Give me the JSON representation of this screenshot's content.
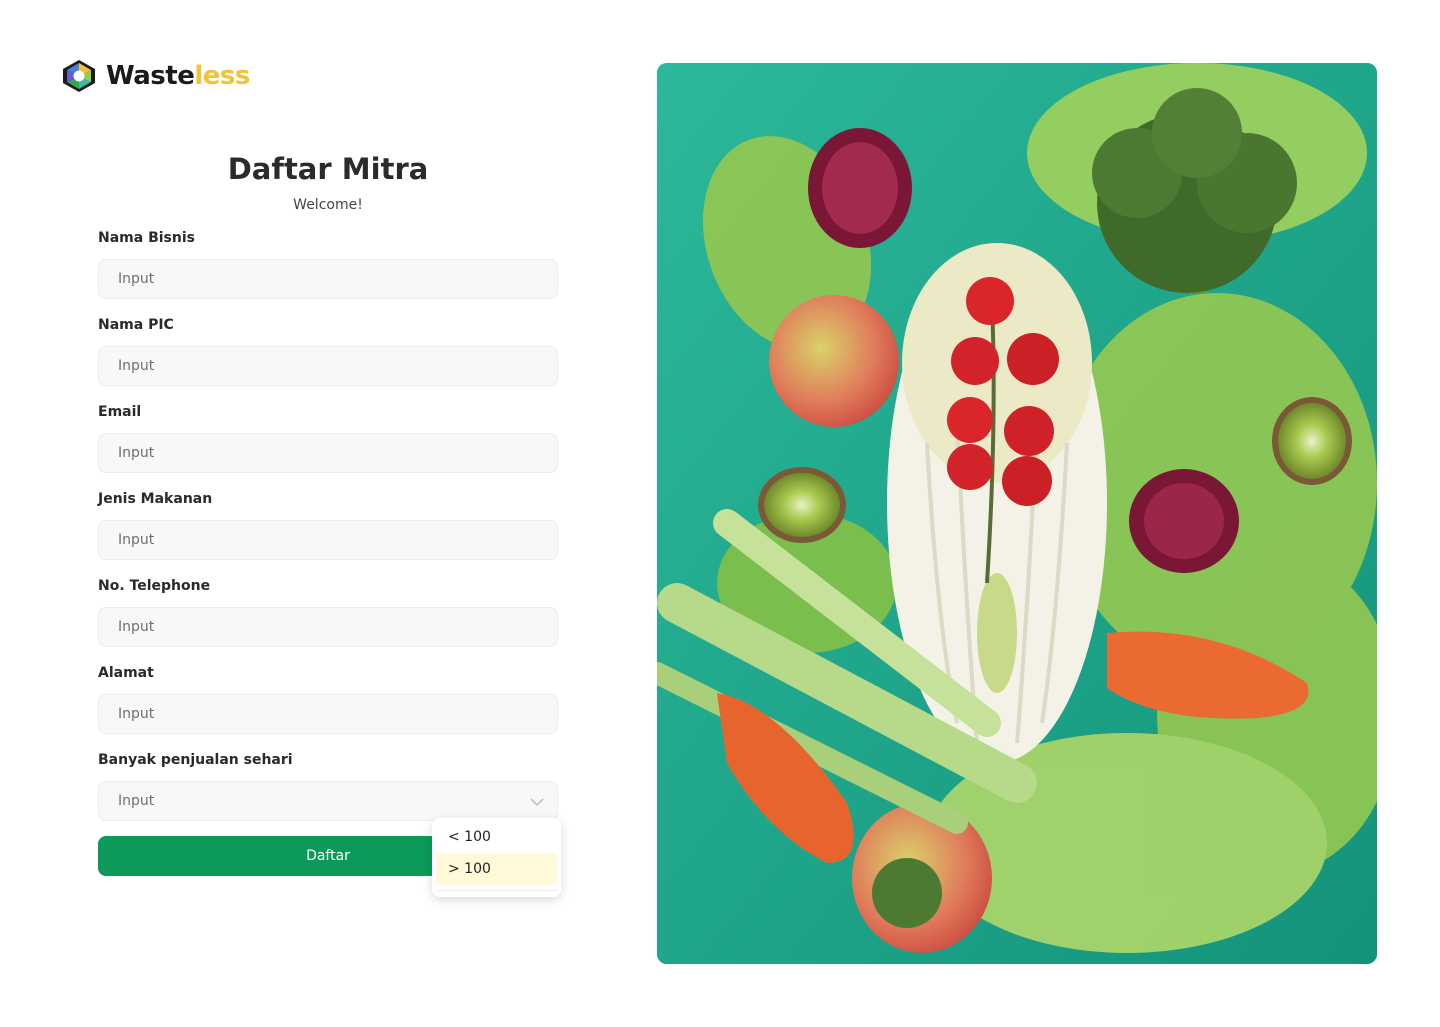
{
  "brand": {
    "name_dark": "Waste",
    "name_accent": "less",
    "colors": {
      "dark": "#1b1b1b",
      "accent": "#f5c231"
    }
  },
  "form": {
    "title": "Daftar Mitra",
    "subtitle": "Welcome!",
    "fields": [
      {
        "label": "Nama Bisnis",
        "placeholder": "Input"
      },
      {
        "label": "Nama PIC",
        "placeholder": "Input"
      },
      {
        "label": "Email",
        "placeholder": "Input"
      },
      {
        "label": "Jenis Makanan",
        "placeholder": "Input"
      },
      {
        "label": "No. Telephone",
        "placeholder": "Input"
      },
      {
        "label": "Alamat",
        "placeholder": "Input"
      }
    ],
    "sales_select": {
      "label": "Banyak penjualan sehari",
      "value": "Input",
      "options": [
        "< 100",
        "> 100"
      ],
      "highlighted_option": "> 100"
    },
    "submit_label": "Daftar"
  },
  "colors": {
    "primary": "#0c9a5b",
    "input_bg": "#f8f8f8",
    "highlight": "#fff8d9",
    "photo_bg": "#1d9d82"
  }
}
